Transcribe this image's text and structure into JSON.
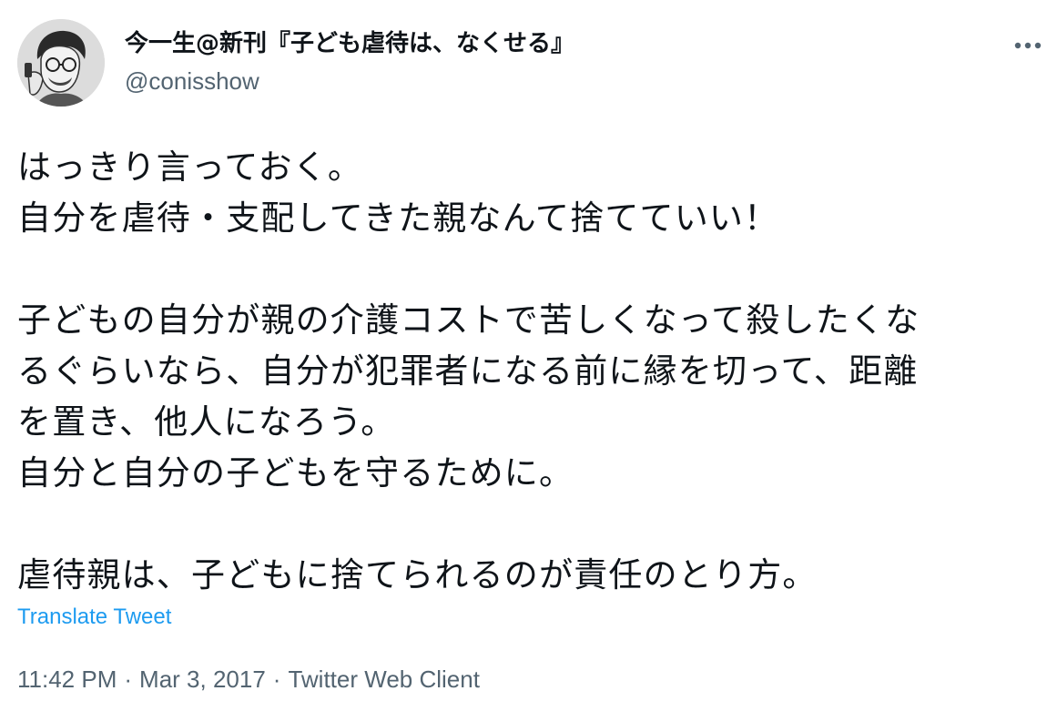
{
  "author": {
    "display_name": "今一生@新刊『子ども虐待は、なくせる』",
    "handle": "@conisshow",
    "avatar_icon": "avatar-portrait-icon"
  },
  "menu": {
    "more_icon": "more-dots-icon"
  },
  "tweet": {
    "paragraphs": [
      "はっきり言っておく。\n自分を虐待・支配してきた親なんて捨てていい！",
      "子どもの自分が親の介護コストで苦しくなって殺したくな\nるぐらいなら、自分が犯罪者になる前に縁を切って、距離\nを置き、他人になろう。\n自分と自分の子どもを守るために。",
      "虐待親は、子どもに捨てられるのが責任のとり方。"
    ]
  },
  "translate_label": "Translate Tweet",
  "meta": {
    "time": "11:42 PM",
    "date": "Mar 3, 2017",
    "client": "Twitter Web Client",
    "separator": "·"
  },
  "colors": {
    "text": "#0f1419",
    "secondary": "#536471",
    "link": "#1d9bf0"
  }
}
